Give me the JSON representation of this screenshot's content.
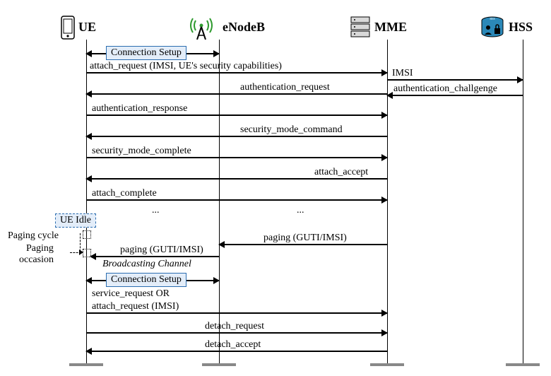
{
  "actors": {
    "ue": "UE",
    "enodeb": "eNodeB",
    "mme": "MME",
    "hss": "HSS"
  },
  "boxes": {
    "connection_setup_1": "Connection Setup",
    "connection_setup_2": "Connection Setup",
    "ue_idle": "UE Idle"
  },
  "side": {
    "paging_cycle": "Paging cycle",
    "paging_occasion_1": "Paging",
    "paging_occasion_2": "occasion"
  },
  "messages": {
    "m1": "attach_request (IMSI, UE's security capabilities)",
    "m2": "IMSI",
    "m3": "authentication_request",
    "m4": "authentication_challgenge",
    "m5": "authentication_response",
    "m6": "security_mode_command",
    "m7": "security_mode_complete",
    "m8": "attach_accept",
    "m9": "attach_complete",
    "ellipsis1": "...",
    "ellipsis2": "...",
    "m10": "paging (GUTI/IMSI)",
    "m11": "paging (GUTI/IMSI)",
    "broadcasting": "Broadcasting Channel",
    "m12": "service_request OR",
    "m13": "attach_request (IMSI)",
    "m14": "detach_request",
    "m15": "detach_accept"
  },
  "chart_data": {
    "type": "sequence_diagram",
    "lifelines": [
      "UE",
      "eNodeB",
      "MME",
      "HSS"
    ],
    "interactions": [
      {
        "from": "UE",
        "to": "eNodeB",
        "type": "bidirectional",
        "label": "Connection Setup"
      },
      {
        "from": "UE",
        "to": "MME",
        "label": "attach_request (IMSI, UE's security capabilities)"
      },
      {
        "from": "MME",
        "to": "HSS",
        "label": "IMSI"
      },
      {
        "from": "HSS",
        "to": "MME",
        "label": "authentication_challgenge"
      },
      {
        "from": "MME",
        "to": "UE",
        "label": "authentication_request"
      },
      {
        "from": "UE",
        "to": "MME",
        "label": "authentication_response"
      },
      {
        "from": "MME",
        "to": "UE",
        "label": "security_mode_command"
      },
      {
        "from": "UE",
        "to": "MME",
        "label": "security_mode_complete"
      },
      {
        "from": "MME",
        "to": "UE",
        "label": "attach_accept"
      },
      {
        "from": "UE",
        "to": "MME",
        "label": "attach_complete"
      },
      {
        "note": "UE Idle state; Paging cycle / Paging occasion annotations on UE lifeline"
      },
      {
        "from": "MME",
        "to": "eNodeB",
        "label": "paging (GUTI/IMSI)"
      },
      {
        "from": "eNodeB",
        "to": "UE",
        "label": "paging (GUTI/IMSI)",
        "channel": "Broadcasting Channel"
      },
      {
        "from": "UE",
        "to": "eNodeB",
        "type": "bidirectional",
        "label": "Connection Setup"
      },
      {
        "from": "UE",
        "to": "MME",
        "label": "service_request OR attach_request (IMSI)"
      },
      {
        "from": "UE",
        "to": "MME",
        "label": "detach_request"
      },
      {
        "from": "MME",
        "to": "UE",
        "label": "detach_accept"
      }
    ]
  }
}
